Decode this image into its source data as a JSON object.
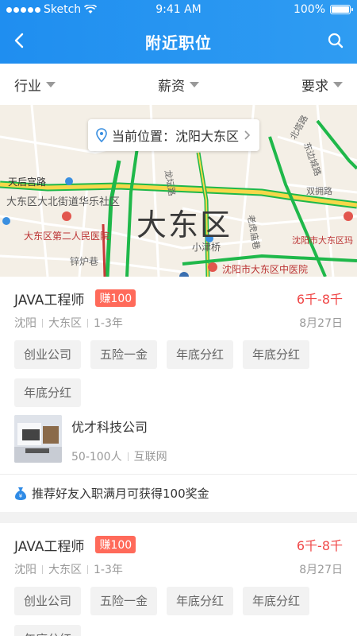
{
  "status_bar": {
    "carrier": "Sketch",
    "time": "9:41 AM",
    "battery": "100%"
  },
  "header": {
    "title": "附近职位"
  },
  "filters": [
    {
      "label": "行业"
    },
    {
      "label": "薪资"
    },
    {
      "label": "要求"
    }
  ],
  "map": {
    "location_label": "当前位置：沈阳大东区",
    "district_label": "大东区",
    "places": [
      "天后宫路",
      "大东区大北街道华乐社区",
      "大东区第二人民医院",
      "锌炉巷",
      "小津桥",
      "沈阳市大东区中医院",
      "沈阳市大东区玛",
      "双拥路",
      "东边城路",
      "龙坛路",
      "北塔路",
      "老虎庙巷"
    ]
  },
  "jobs": [
    {
      "title": "JAVA工程师",
      "earn_badge": "赚100",
      "salary": "6千-8千",
      "city": "沈阳",
      "district": "大东区",
      "experience": "1-3年",
      "date": "8月27日",
      "tags": [
        "创业公司",
        "五险一金",
        "年底分红",
        "年底分红",
        "年底分红"
      ],
      "company": {
        "name": "优才科技公司",
        "size": "50-100人",
        "industry": "互联网"
      },
      "recommend_text": "推荐好友入职满月可获得100奖金"
    },
    {
      "title": "JAVA工程师",
      "earn_badge": "赚100",
      "salary": "6千-8千",
      "city": "沈阳",
      "district": "大东区",
      "experience": "1-3年",
      "date": "8月27日",
      "tags": [
        "创业公司",
        "五险一金",
        "年底分红",
        "年底分红",
        "年底分红"
      ]
    }
  ],
  "colors": {
    "header": "#1f8ef0",
    "salary": "#f04848",
    "earn_badge": "#ff6a5a"
  }
}
